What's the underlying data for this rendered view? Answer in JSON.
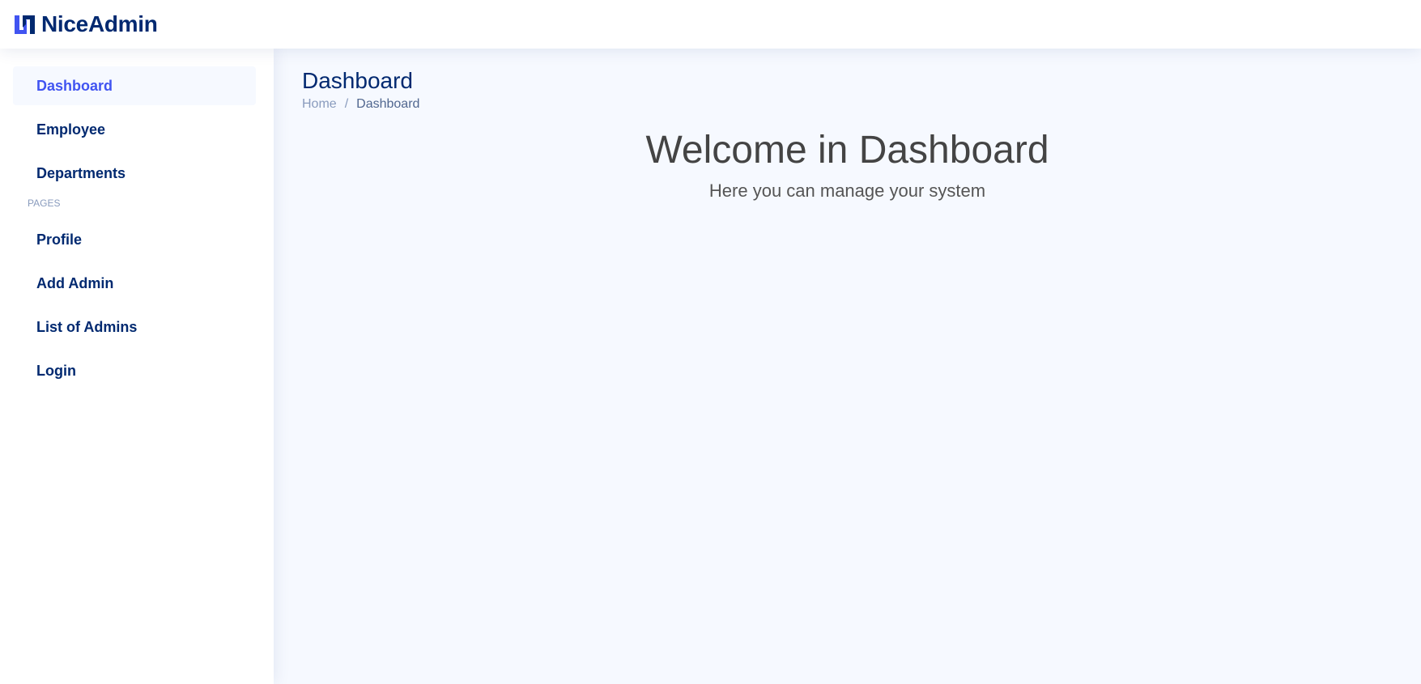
{
  "header": {
    "brand": "NiceAdmin",
    "logo_icon": "niceadmin-logo-icon",
    "accent_color": "#4154f1",
    "brand_color": "#012970"
  },
  "sidebar": {
    "items": [
      {
        "label": "Dashboard",
        "active": true
      },
      {
        "label": "Employee"
      },
      {
        "label": "Departments"
      }
    ],
    "pages_heading": "PAGES",
    "pages": [
      {
        "label": "Profile"
      },
      {
        "label": "Add Admin"
      },
      {
        "label": "List of Admins"
      },
      {
        "label": "Login"
      }
    ]
  },
  "main": {
    "page_title": "Dashboard",
    "breadcrumb": {
      "home": "Home",
      "separator": "/",
      "current": "Dashboard"
    },
    "welcome_title": "Welcome in Dashboard",
    "welcome_subtitle": "Here you can manage your system"
  }
}
